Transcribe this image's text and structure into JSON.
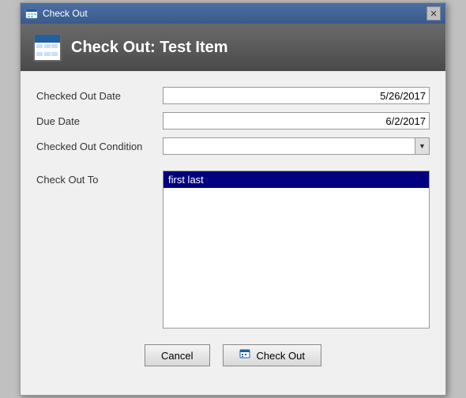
{
  "window": {
    "title": "Check Out",
    "close_label": "✕"
  },
  "header": {
    "title": "Check Out: Test Item"
  },
  "form": {
    "checked_out_date_label": "Checked Out Date",
    "checked_out_date_value": "5/26/2017",
    "due_date_label": "Due Date",
    "due_date_value": "6/2/2017",
    "checked_out_condition_label": "Checked Out Condition",
    "checked_out_condition_value": "",
    "check_out_to_label": "Check Out To",
    "check_out_to_selected": "first last"
  },
  "buttons": {
    "cancel_label": "Cancel",
    "checkout_label": "Check Out"
  }
}
